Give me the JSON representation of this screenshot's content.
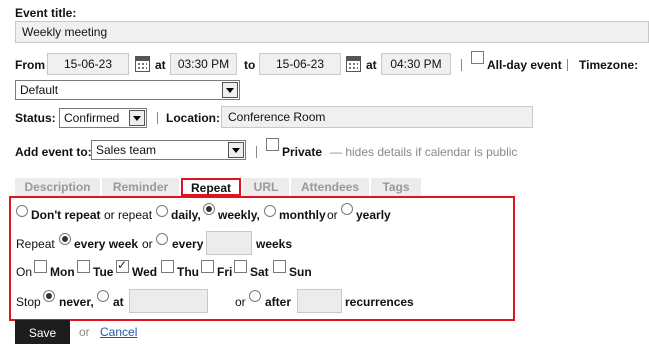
{
  "event_title": {
    "label": "Event title:",
    "value": "Weekly meeting"
  },
  "from": {
    "label": "From",
    "date": "15-06-23",
    "at_label": "at",
    "time": "03:30 PM"
  },
  "to": {
    "label": "to",
    "date": "15-06-23",
    "at_label": "at",
    "time": "04:30 PM"
  },
  "all_day": {
    "label": "All-day event",
    "checked": false
  },
  "timezone": {
    "label": "Timezone:",
    "value": "Default"
  },
  "status": {
    "label": "Status:",
    "value": "Confirmed"
  },
  "location": {
    "label": "Location:",
    "value": "Conference Room"
  },
  "add_event_to": {
    "label": "Add event to:",
    "value": "Sales team"
  },
  "private": {
    "label": "Private",
    "hint": "— hides details if calendar is public",
    "checked": false
  },
  "tabs": [
    {
      "label": "Description",
      "active": false
    },
    {
      "label": "Reminder",
      "active": false
    },
    {
      "label": "Repeat",
      "active": true
    },
    {
      "label": "URL",
      "active": false
    },
    {
      "label": "Attendees",
      "active": false
    },
    {
      "label": "Tags",
      "active": false
    }
  ],
  "repeat": {
    "row1": {
      "dont_repeat": "Don't repeat",
      "or_repeat": "or repeat",
      "daily": "daily,",
      "weekly": "weekly,",
      "monthly": "monthly",
      "or": "or",
      "yearly": "yearly",
      "selected": "weekly"
    },
    "row2": {
      "label": "Repeat",
      "every_week": "every week",
      "or": "or",
      "every": "every",
      "weeks": "weeks",
      "selected": "every_week"
    },
    "row3": {
      "label": "On",
      "days": [
        {
          "label": "Mon",
          "checked": false
        },
        {
          "label": "Tue",
          "checked": false
        },
        {
          "label": "Wed",
          "checked": true
        },
        {
          "label": "Thu",
          "checked": false
        },
        {
          "label": "Fri",
          "checked": false
        },
        {
          "label": "Sat",
          "checked": false
        },
        {
          "label": "Sun",
          "checked": false
        }
      ]
    },
    "row4": {
      "label": "Stop",
      "never": "never,",
      "at": "at",
      "or": "or",
      "after": "after",
      "recurrences": "recurrences",
      "selected": "never"
    }
  },
  "actions": {
    "save": "Save",
    "or": "or",
    "cancel": "Cancel"
  },
  "colors": {
    "highlight": "#e0141e",
    "link": "#2257a8",
    "field_bg": "#f0f0f0"
  }
}
